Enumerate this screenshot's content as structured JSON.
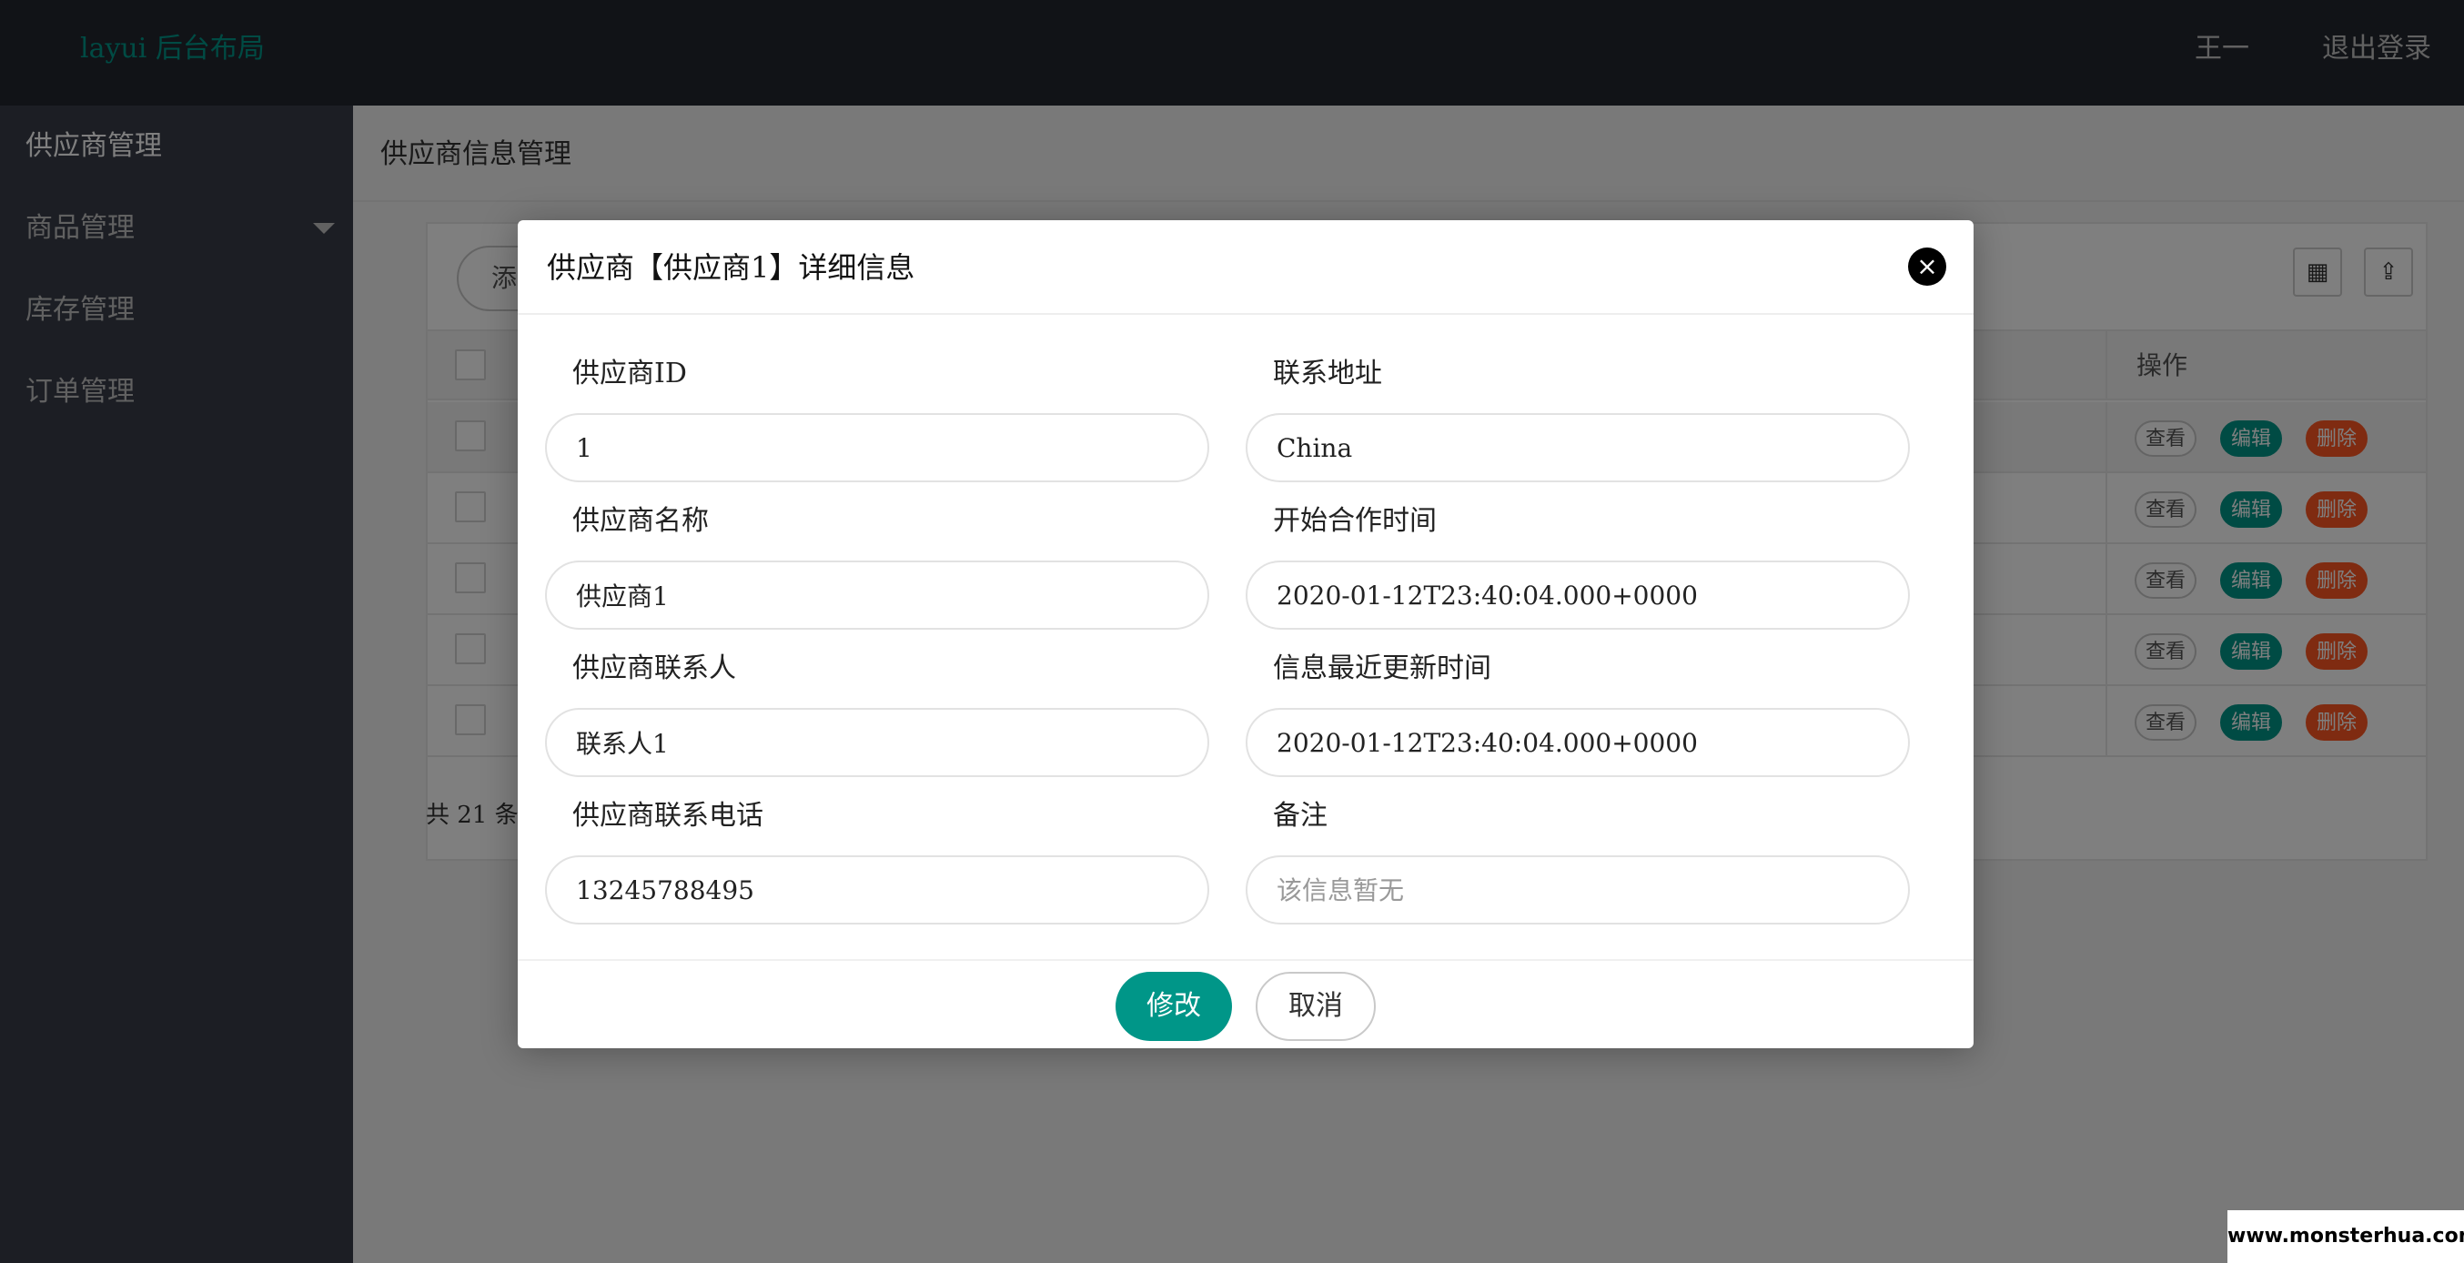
{
  "header": {
    "logo": "layui 后台布局",
    "user": "王一",
    "logout": "退出登录"
  },
  "sidebar": {
    "items": [
      {
        "label": "供应商管理"
      },
      {
        "label": "商品管理"
      },
      {
        "label": "库存管理"
      },
      {
        "label": "订单管理"
      }
    ]
  },
  "main": {
    "title": "供应商信息管理",
    "add_button": "添",
    "ops_header": "操作",
    "row_actions": {
      "view": "查看",
      "edit": "编辑",
      "delete": "删除"
    },
    "total": "共 21 条"
  },
  "dialog": {
    "title": "供应商【供应商1】详细信息",
    "close_icon": "×",
    "fields": {
      "supplier_id": {
        "label": "供应商ID",
        "value": "1"
      },
      "address": {
        "label": "联系地址",
        "value": "China"
      },
      "name": {
        "label": "供应商名称",
        "value": "供应商1"
      },
      "start_time": {
        "label": "开始合作时间",
        "value": "2020-01-12T23:40:04.000+0000"
      },
      "contact": {
        "label": "供应商联系人",
        "value": "联系人1"
      },
      "updated_time": {
        "label": "信息最近更新时间",
        "value": "2020-01-12T23:40:04.000+0000"
      },
      "phone": {
        "label": "供应商联系电话",
        "value": "13245788495"
      },
      "note": {
        "label": "备注",
        "placeholder": "该信息暂无"
      }
    },
    "modify_button": "修改",
    "cancel_button": "取消"
  },
  "watermark": "www.monsterhua.com",
  "colors": {
    "accent": "#009688",
    "danger": "#ff5722",
    "header_bg": "#23262e",
    "sidebar_bg": "#393d49"
  }
}
